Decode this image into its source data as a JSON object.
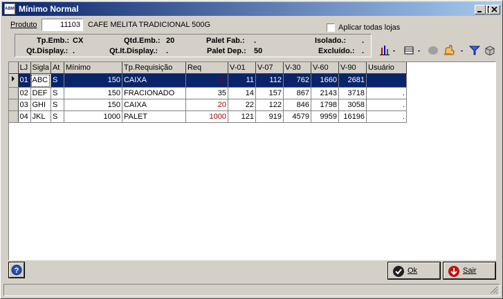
{
  "window": {
    "title": "Mínimo Normal",
    "icon_text": "ABM"
  },
  "product": {
    "label": "Produto",
    "code": "11103",
    "description": "CAFE MELITA TRADICIONAL 500G"
  },
  "apply_all": {
    "label": "Aplicar todas lojas",
    "checked": false
  },
  "info": {
    "tp_emb_label": "Tp.Emb.:",
    "tp_emb_value": "CX",
    "qtd_emb_label": "Qtd.Emb.:",
    "qtd_emb_value": "20",
    "palet_fab_label": "Palet Fab.:",
    "palet_fab_value": ".",
    "isolado_label": "Isolado.:",
    "isolado_value": ".",
    "qt_display_label": "Qt.Display.:",
    "qt_display_value": ".",
    "qt_it_display_label": "Qt.It.Display.:",
    "qt_it_display_value": ".",
    "palet_dep_label": "Palet Dep.:",
    "palet_dep_value": "50",
    "excluido_label": "Excluído.:",
    "excluido_value": "."
  },
  "toolbar": [
    "chart-icon",
    "columns-icon",
    "circle-icon",
    "hand-icon",
    "filter-icon",
    "box-icon"
  ],
  "grid": {
    "columns": [
      "LJ",
      "Sigla",
      "At",
      "Mínimo",
      "Tp.Requisição",
      "Req",
      "V-01",
      "V-07",
      "V-30",
      "V-60",
      "V-90",
      "Usuário"
    ],
    "rows": [
      {
        "lj": "01",
        "sigla": "ABC",
        "at": "S",
        "minimo": "150",
        "tp": "CAIXA",
        "req": "20",
        "v01": "11",
        "v07": "112",
        "v30": "762",
        "v60": "1660",
        "v90": "2681",
        "usuario": ""
      },
      {
        "lj": "02",
        "sigla": "DEF",
        "at": "S",
        "minimo": "150",
        "tp": "FRACIONADO",
        "req": "35",
        "v01": "14",
        "v07": "157",
        "v30": "867",
        "v60": "2143",
        "v90": "3718",
        "usuario": "."
      },
      {
        "lj": "03",
        "sigla": "GHI",
        "at": "S",
        "minimo": "150",
        "tp": "CAIXA",
        "req": "20",
        "v01": "22",
        "v07": "122",
        "v30": "846",
        "v60": "1798",
        "v90": "3058",
        "usuario": "."
      },
      {
        "lj": "04",
        "sigla": "JKL",
        "at": "S",
        "minimo": "1000",
        "tp": "PALET",
        "req": "1000",
        "v01": "121",
        "v07": "919",
        "v30": "4579",
        "v60": "9959",
        "v90": "16196",
        "usuario": "."
      }
    ]
  },
  "buttons": {
    "ok": "Ok",
    "exit": "Sair"
  },
  "colors": {
    "title_start": "#0a246a",
    "title_end": "#a6caf0",
    "selection": "#0a246a",
    "req_red": "#a00000"
  }
}
